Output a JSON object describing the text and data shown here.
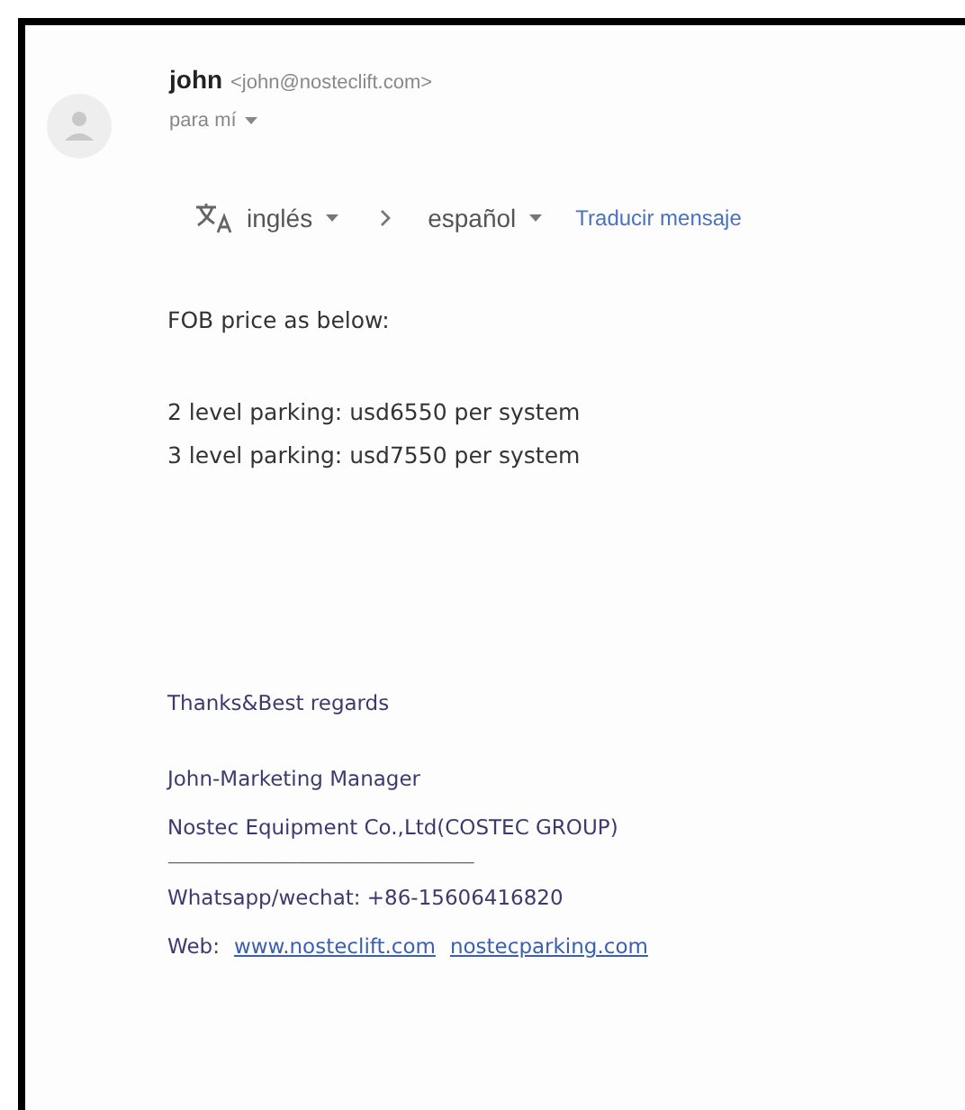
{
  "sender": {
    "name": "john",
    "email": "<john@nosteclift.com>",
    "recipient": "para mí"
  },
  "translate": {
    "from": "inglés",
    "to": "español",
    "action": "Traducir mensaje"
  },
  "body": [
    "FOB price as below:",
    "2 level parking: usd6550 per system",
    "3 level parking: usd7550 per system"
  ],
  "signature": {
    "greeting": "Thanks&Best regards",
    "lines": [
      "John-Marketing Manager",
      "Nostec Equipment Co.,Ltd(COSTEC GROUP)"
    ],
    "separator": "------------------------------------------------------------------------------------------",
    "contact": "Whatsapp/wechat: +86-15606416820",
    "web_label": "Web:",
    "links": [
      "www.nosteclift.com",
      "nostecparking.com"
    ]
  }
}
